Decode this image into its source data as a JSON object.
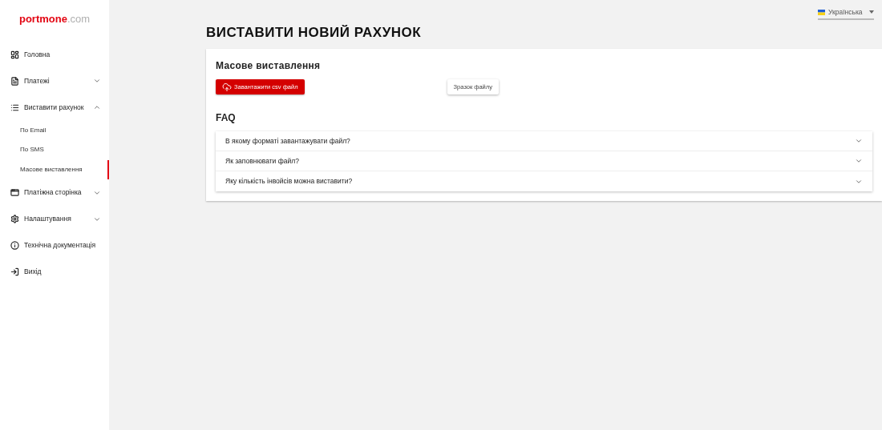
{
  "logo": {
    "brand": "portmone",
    "domain": ".com"
  },
  "sidebar": {
    "items": [
      {
        "kind": "dashboard",
        "label": "Головна"
      },
      {
        "kind": "document",
        "label": "Платежі",
        "expanded": false
      },
      {
        "kind": "list",
        "label": "Виставити рахунок",
        "expanded": true,
        "children": [
          {
            "label": "По Email",
            "selected": false
          },
          {
            "label": "По SMS",
            "selected": false
          },
          {
            "label": "Масове виставлення",
            "selected": true
          }
        ]
      },
      {
        "kind": "window",
        "label": "Платіжна сторінка",
        "expanded": false
      },
      {
        "kind": "gear",
        "label": "Налаштування",
        "expanded": false
      },
      {
        "kind": "info",
        "label": "Технічна документація"
      },
      {
        "kind": "exit",
        "label": "Вихід"
      }
    ]
  },
  "language": {
    "value": "Українська"
  },
  "page_title": "ВИСТАВИТИ НОВИЙ РАХУНОК",
  "card": {
    "title": "Масове виставлення",
    "upload_button": "Завантажити csv файл",
    "sample_button": "Зразок файлу",
    "faq_title": "FAQ",
    "faq": [
      {
        "question": "В якому форматі завантажувати файл?",
        "expanded": false
      },
      {
        "question": "Як заповнювати файл?",
        "expanded": false
      },
      {
        "question": "Яку кількість інвойсів можна виставити?",
        "expanded": false
      }
    ]
  }
}
